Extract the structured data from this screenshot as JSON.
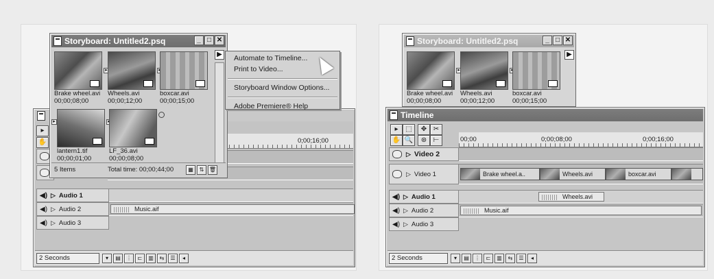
{
  "left": {
    "storyboard": {
      "title": "Storyboard: Untitled2.psq",
      "clips": [
        {
          "name": "Brake wheel.avi",
          "duration": "00;00;08;00"
        },
        {
          "name": "Wheels.avi",
          "duration": "00;00;12;00"
        },
        {
          "name": "boxcar.avi",
          "duration": "00;00;15;00"
        },
        {
          "name": "lantern1.tif",
          "duration": "00;00;01;00"
        },
        {
          "name": "LF_36.avi",
          "duration": "00;00;08;00"
        }
      ],
      "items_count": "5 Items",
      "total_time": "Total time: 00;00;44;00"
    },
    "menu": {
      "items": [
        "Automate to Timeline...",
        "Print to Video...",
        "Storyboard Window Options...",
        "Adobe Premiere® Help"
      ]
    },
    "timeline": {
      "ruler_time": "0;00;16;00",
      "tracks": {
        "audio1": "Audio 1",
        "audio2": "Audio 2",
        "audio3": "Audio 3"
      },
      "music_clip": "Music.aif",
      "zoom": "2 Seconds"
    }
  },
  "right": {
    "storyboard": {
      "title": "Storyboard: Untitled2.psq",
      "clips": [
        {
          "name": "Brake wheel.avi",
          "duration": "00;00;08;00"
        },
        {
          "name": "Wheels.avi",
          "duration": "00;00;12;00"
        },
        {
          "name": "boxcar.avi",
          "duration": "00;00;15;00"
        }
      ]
    },
    "timeline": {
      "title": "Timeline",
      "ruler": [
        "00;00",
        "0;00;08;00",
        "0;00;16;00"
      ],
      "tracks": {
        "video2": "Video 2",
        "video1": "Video 1",
        "audio1": "Audio 1",
        "audio2": "Audio 2",
        "audio3": "Audio 3"
      },
      "video_clips": [
        "Brake wheel.a..",
        "Wheels.avi",
        "boxcar.avi"
      ],
      "audio_clip": "Wheels.avi",
      "music_clip": "Music.aif",
      "zoom": "2 Seconds"
    }
  }
}
